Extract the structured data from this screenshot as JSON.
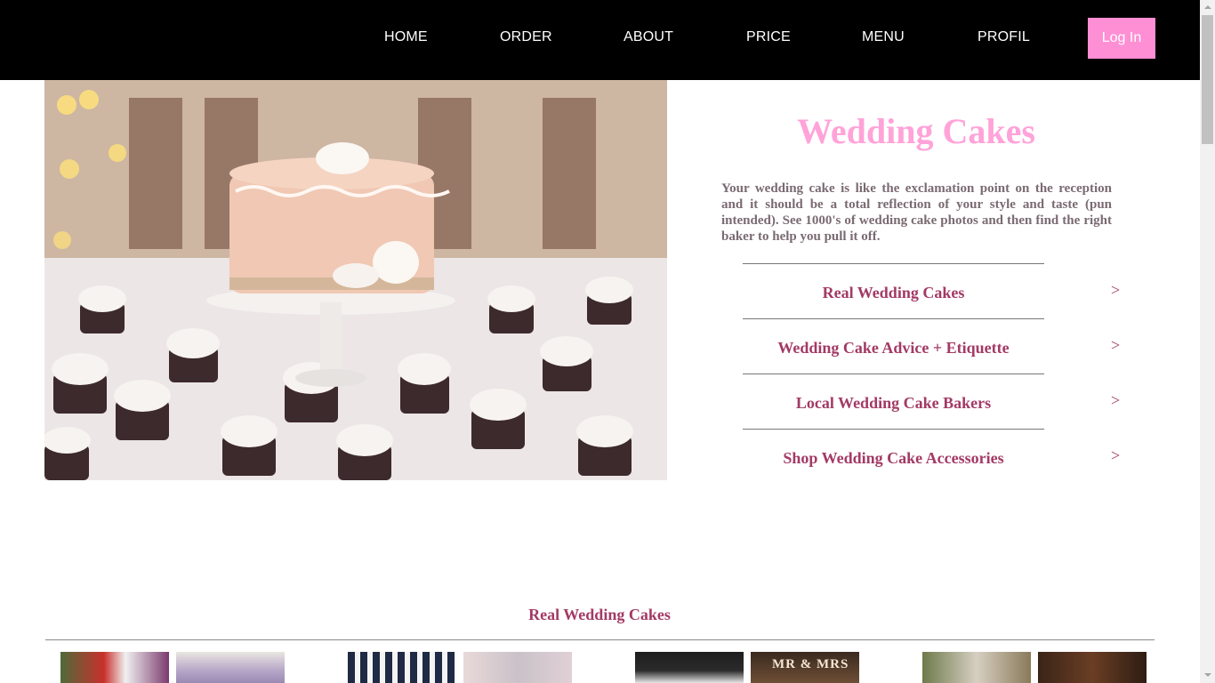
{
  "nav": {
    "items": [
      "HOME",
      "ORDER",
      "ABOUT",
      "PRICE",
      "MENU",
      "PROFIL"
    ],
    "login_label": "Log In",
    "login_color": "#ff8fd4"
  },
  "hero": {
    "title": "Wedding Cakes",
    "intro": "Your wedding cake is like the exclamation point on the reception and it should be a total reflection of your style and taste (pun intended). See 1000's of wedding cake photos and then find the right baker to help you pull it off.",
    "title_color": "#ffa3d9"
  },
  "links": [
    {
      "label": "Real Wedding Cakes",
      "chevron": ">"
    },
    {
      "label": "Wedding Cake Advice + Etiquette",
      "chevron": ">"
    },
    {
      "label": "Local Wedding Cake Bakers",
      "chevron": ">"
    },
    {
      "label": "Shop Wedding Cake Accessories",
      "chevron": ">"
    }
  ],
  "section": {
    "title": "Real Wedding Cakes",
    "thumb_sign_text": "MR & MRS"
  },
  "colors": {
    "accent": "#a33a64",
    "body_text": "#7a6a72"
  }
}
